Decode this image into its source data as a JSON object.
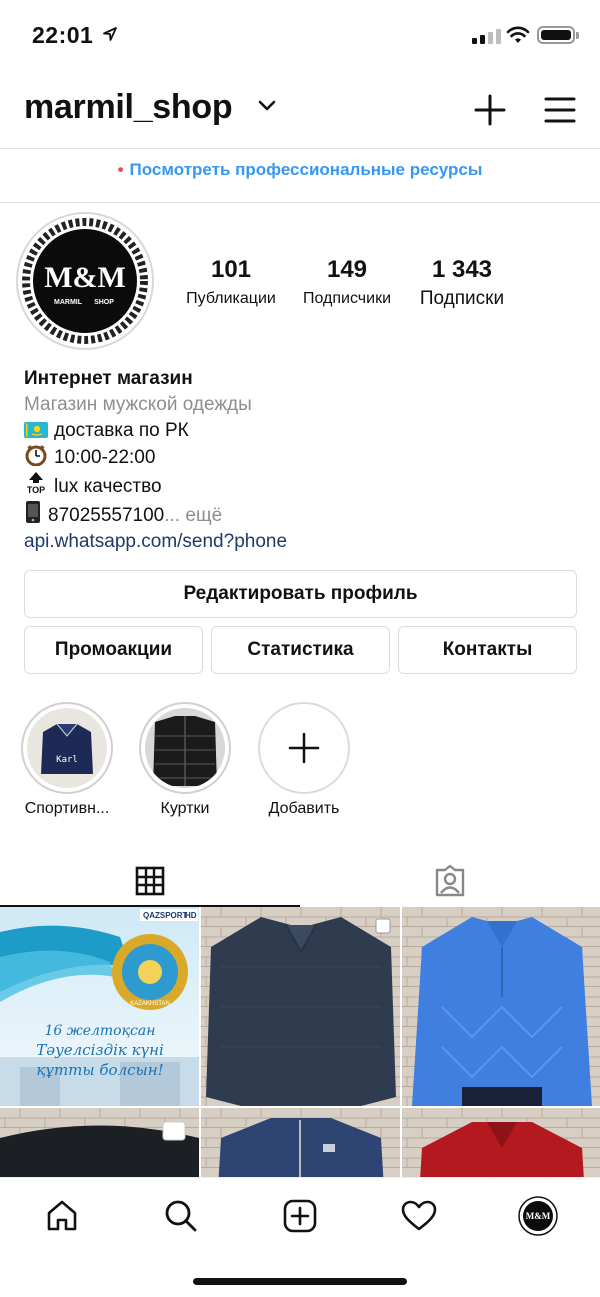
{
  "status_bar": {
    "time": "22:01"
  },
  "header": {
    "username": "marmil_shop"
  },
  "pro_link": "Посмотреть профессиональные ресурсы",
  "avatar": {
    "logo_text": "M&M",
    "logo_sub_left": "MARMIL",
    "logo_sub_right": "SHOP"
  },
  "stats": [
    {
      "value": "101",
      "label": "Публикации"
    },
    {
      "value": "149",
      "label": "Подписчики"
    },
    {
      "value": "1 343",
      "label": "Подписки"
    }
  ],
  "bio": {
    "name": "Интернет магазин",
    "category": "Магазин мужской одежды",
    "line_delivery": "доставка по РК",
    "line_hours": "10:00-22:00",
    "line_quality": "lux качество",
    "line_phone": "87025557100",
    "phone_ellipsis": "...",
    "more": "ещё",
    "link": "api.whatsapp.com/send?phone",
    "top_badge": "TOP"
  },
  "buttons": {
    "edit_profile": "Редактировать профиль",
    "promotions": "Промоакции",
    "statistics": "Статистика",
    "contacts": "Контакты"
  },
  "highlights": [
    {
      "label": "Спортивн...",
      "image_text": "Karl"
    },
    {
      "label": "Куртки"
    },
    {
      "label": "Добавить"
    }
  ],
  "posts": {
    "first": {
      "channel": "QAZSPORT",
      "hd": "HD",
      "line1": "16 желтоқсан",
      "line2": "Тәуелсіздік күні",
      "line3": "құтты болсын!",
      "emblem": "KAZAKHSTAN"
    }
  },
  "colors": {
    "accent": "#3897f0",
    "dot": "#ed4956",
    "link": "#1f3a68"
  }
}
